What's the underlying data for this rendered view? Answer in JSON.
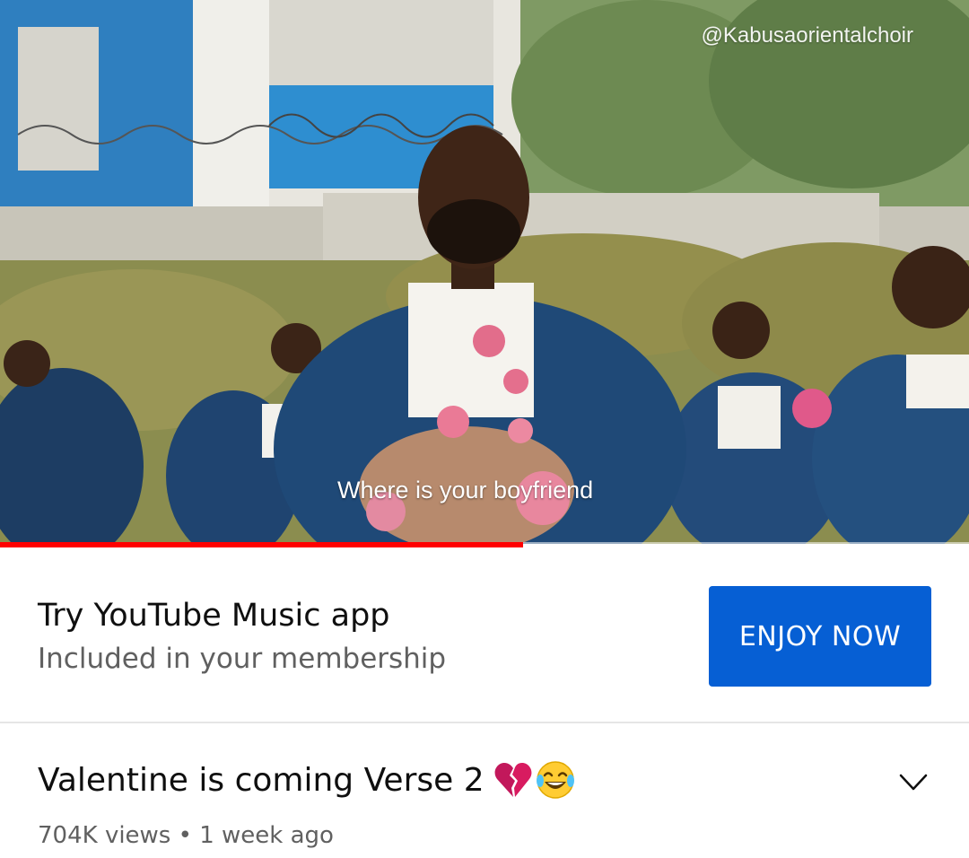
{
  "video": {
    "watermark": "@Kabusaorientalchoir",
    "caption": "Where is your boyfriend",
    "progress_fraction": 0.54
  },
  "promo": {
    "title": "Try YouTube Music app",
    "subtitle": "Included in your membership",
    "button_label": "ENJOY NOW"
  },
  "details": {
    "title": "Valentine is coming Verse 2",
    "emojis": [
      "broken-heart-icon",
      "tears-of-joy-icon"
    ],
    "views": "704K views",
    "separator": "•",
    "age": "1 week ago"
  },
  "colors": {
    "accent": "#065fd4",
    "progress": "#ff0000",
    "secondary_text": "#606060"
  }
}
